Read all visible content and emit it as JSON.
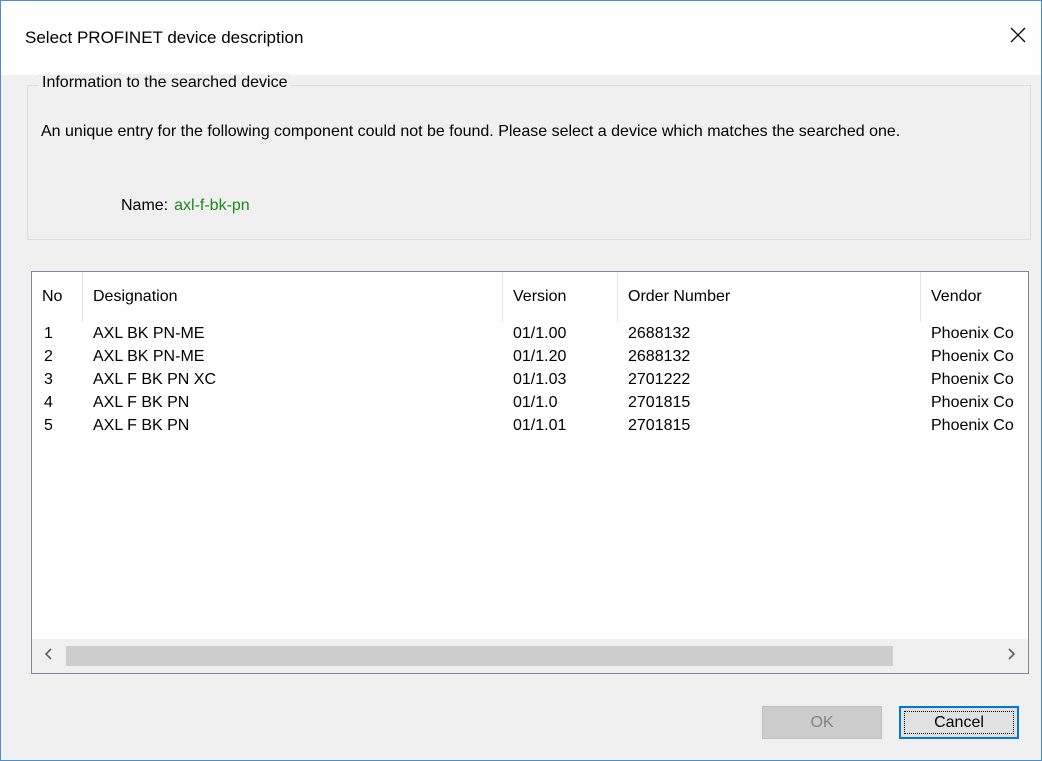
{
  "window": {
    "title": "Select PROFINET device description"
  },
  "info_group": {
    "label": "Information to the searched device",
    "message": "An unique entry for the following component could not be found. Please select a device which matches the searched one.",
    "name_label": "Name:",
    "name_value": "axl-f-bk-pn"
  },
  "table": {
    "columns": [
      "No",
      "Designation",
      "Version",
      "Order Number",
      "Vendor"
    ],
    "rows": [
      [
        "1",
        "AXL BK PN-ME",
        "01/1.00",
        "2688132",
        "Phoenix Co"
      ],
      [
        "2",
        "AXL BK PN-ME",
        "01/1.20",
        "2688132",
        "Phoenix Co"
      ],
      [
        "3",
        "AXL F BK PN XC",
        "01/1.03",
        "2701222",
        "Phoenix Co"
      ],
      [
        "4",
        "AXL F BK PN",
        "01/1.0",
        "2701815",
        "Phoenix Co"
      ],
      [
        "5",
        "AXL F BK PN",
        "01/1.01",
        "2701815",
        "Phoenix Co"
      ]
    ]
  },
  "buttons": {
    "ok": "OK",
    "cancel": "Cancel"
  },
  "colors": {
    "name_value": "#1a8a1a",
    "focus_border": "#0078d7",
    "window_border": "#4a8fd6"
  },
  "icons": {
    "close": "close-icon",
    "scroll_left": "chevron-left-icon",
    "scroll_right": "chevron-right-icon"
  }
}
